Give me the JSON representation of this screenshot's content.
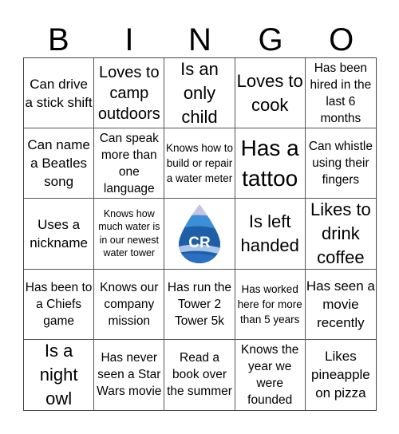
{
  "header": {
    "letters": [
      "B",
      "I",
      "N",
      "G",
      "O"
    ]
  },
  "cells": [
    "Can drive a stick shift",
    "Loves to camp outdoors",
    "Is an only child",
    "Loves to cook",
    "Has been hired in the last 6 months",
    "Can name a Beatles song",
    "Can speak more than one language",
    "Knows how to build or repair a water meter",
    "Has a tattoo",
    "Can whistle using their fingers",
    "Uses a nickname",
    "Knows how much water is in our newest water tower",
    "",
    "Is left handed",
    "Likes to drink coffee",
    "Has been to a Chiefs game",
    "Knows our company mission",
    "Has run the Tower 2 Tower 5k",
    "Has worked here for more than 5 years",
    "Has seen a movie recently",
    "Is a night owl",
    "Has never seen a Star Wars movie",
    "Read a book over the summer",
    "Knows the year we were founded",
    "Likes pineapple on pizza"
  ],
  "free_space": {
    "icon": "water-drop-logo-icon",
    "text": "CR",
    "colors": {
      "dark": "#1f5fa8",
      "mid": "#3a8fd6",
      "light": "#a9c6e8",
      "pale": "#c9c3e3"
    }
  }
}
